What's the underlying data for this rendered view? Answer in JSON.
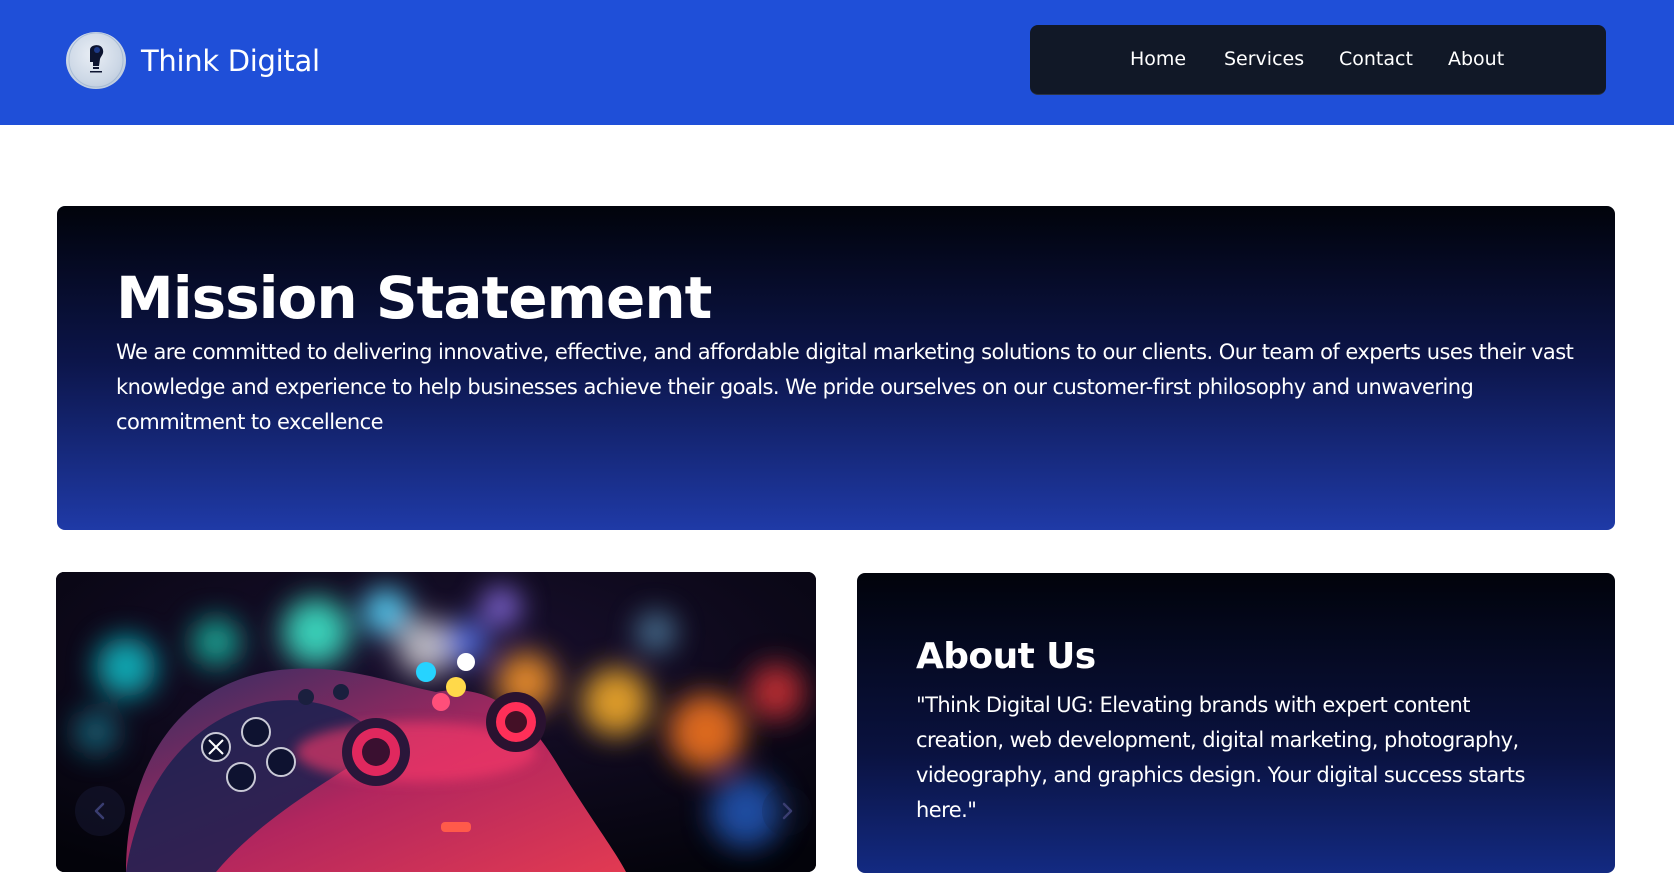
{
  "header": {
    "brand_name": "Think Digital",
    "logo_icon": "bulb-head-logo",
    "background_color": "#1f4fd8"
  },
  "nav": {
    "background_color": "#111827",
    "items": [
      {
        "label": "Home"
      },
      {
        "label": "Services"
      },
      {
        "label": "Contact"
      },
      {
        "label": "About"
      }
    ]
  },
  "mission": {
    "title": "Mission Statement",
    "body": "We are committed to delivering innovative, effective, and affordable digital marketing solutions to our clients. Our team of experts uses their vast knowledge and experience to help businesses achieve their goals. We pride ourselves on our customer-first philosophy and unwavering commitment to excellence",
    "gradient": [
      "#01030b",
      "#1f3aa7"
    ]
  },
  "carousel": {
    "image_subject": "game-controller-photo",
    "prev_icon": "chevron-left-icon",
    "next_icon": "chevron-right-icon"
  },
  "about": {
    "title": "About Us",
    "body": "\"Think Digital UG: Elevating brands with expert content creation, web development, digital marketing, photography, videography, and graphics design. Your digital success starts here.\""
  }
}
